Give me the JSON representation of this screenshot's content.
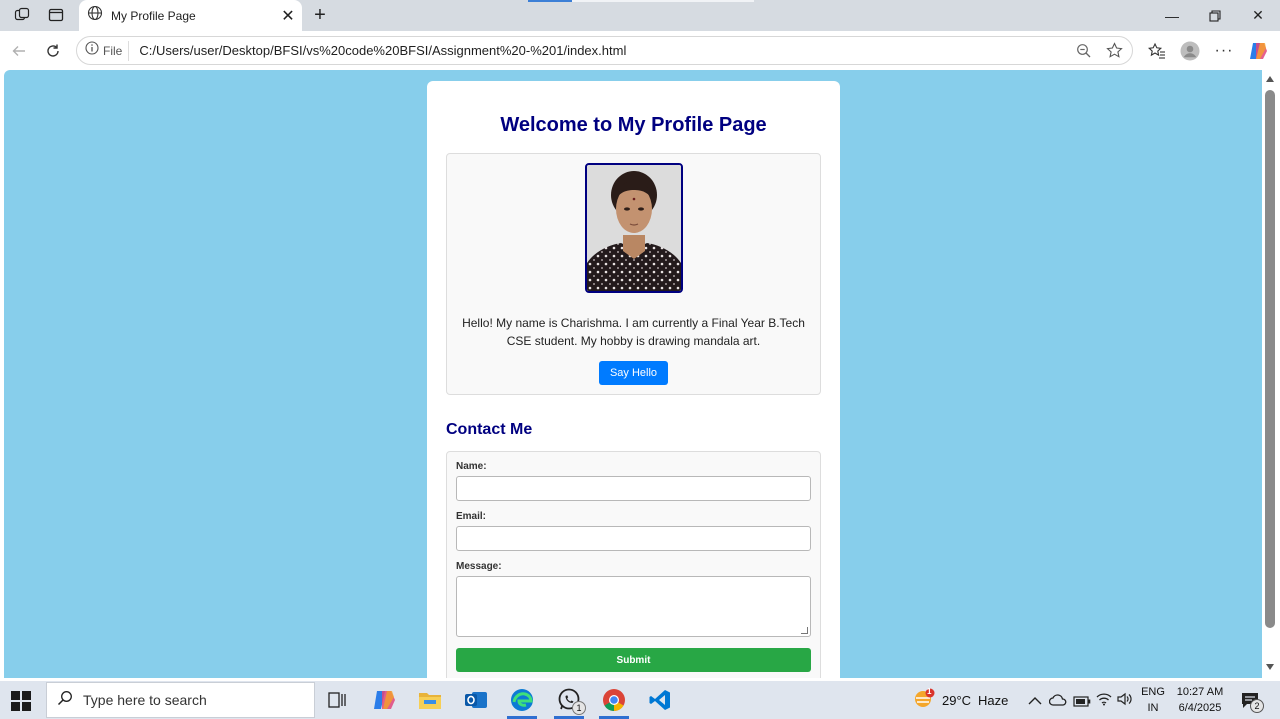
{
  "browser": {
    "tab_title": "My Profile Page",
    "file_label": "File",
    "url": "C:/Users/user/Desktop/BFSI/vs%20code%20BFSI/Assignment%20-%201/index.html"
  },
  "page": {
    "heading": "Welcome to My Profile Page",
    "bio": "Hello! My name is Charishma. I am currently a Final Year B.Tech CSE student. My hobby is drawing mandala art.",
    "hello_button": "Say Hello",
    "contact_heading": "Contact Me",
    "form": {
      "name_label": "Name:",
      "email_label": "Email:",
      "message_label": "Message:",
      "name_value": "",
      "email_value": "",
      "message_value": "",
      "submit_label": "Submit"
    }
  },
  "taskbar": {
    "search_placeholder": "Type here to search",
    "weather_temp": "29°C",
    "weather_desc": "Haze",
    "weather_badge": "1",
    "language": "ENG",
    "region": "IN",
    "time": "10:27 AM",
    "date": "6/4/2025",
    "whatsapp_badge": "1",
    "notification_count": "2"
  },
  "colors": {
    "page_bg": "#87ceeb",
    "heading": "#000080",
    "hello_button": "#007bff",
    "submit_button": "#28a745"
  }
}
